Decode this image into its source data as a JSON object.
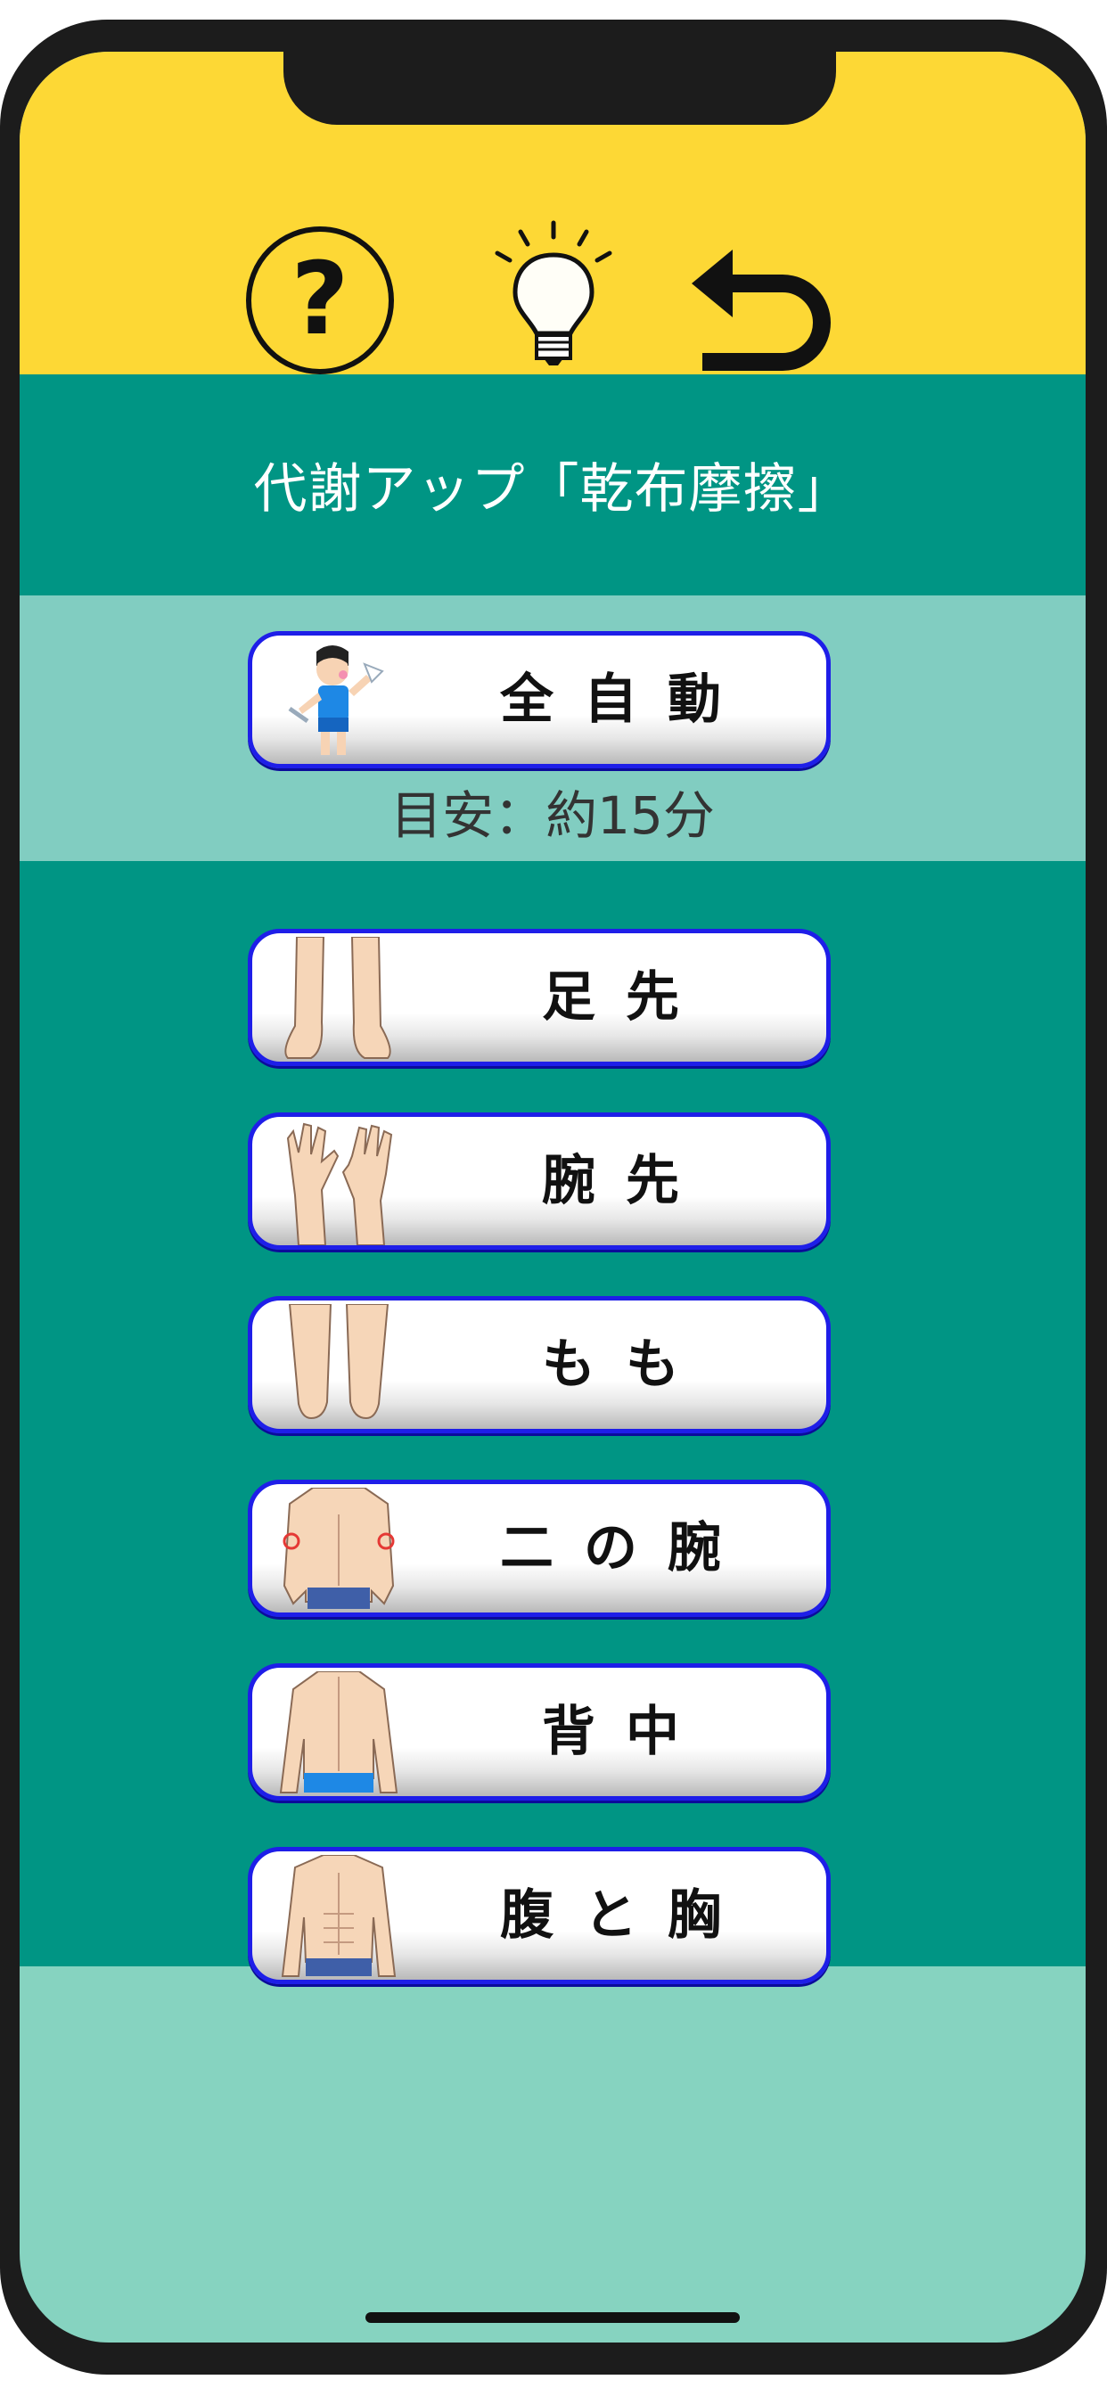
{
  "header": {
    "help_icon": "question-circle-icon",
    "tips_icon": "lightbulb-icon",
    "back_icon": "return-arrow-icon",
    "background": "#fdd835"
  },
  "title": "代謝アップ「乾布摩擦」",
  "auto": {
    "label": "全自動",
    "estimate": "目安：約15分",
    "icon": "exercise-boy-icon"
  },
  "parts": [
    {
      "label": "足先",
      "icon": "feet-icon"
    },
    {
      "label": "腕先",
      "icon": "hands-icon"
    },
    {
      "label": "もも",
      "icon": "thighs-icon"
    },
    {
      "label": "二の腕",
      "icon": "upper-arms-icon"
    },
    {
      "label": "背中",
      "icon": "back-icon"
    },
    {
      "label": "腹と胸",
      "icon": "chest-abdomen-icon"
    }
  ],
  "colors": {
    "teal": "#009584",
    "light_teal": "#81cdc1",
    "mint": "#86d3c0",
    "button_border": "#1e1ee8"
  }
}
